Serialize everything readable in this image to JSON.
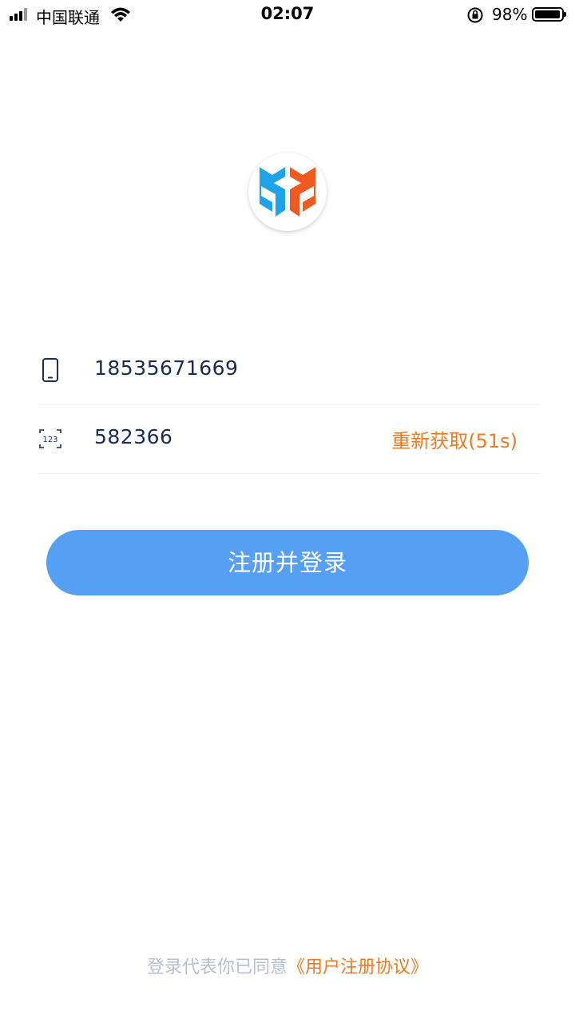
{
  "status_bar": {
    "carrier": "中国联通",
    "time": "02:07",
    "battery": "98%"
  },
  "form": {
    "phone_value": "18535671669",
    "code_value": "582366",
    "resend_label": "重新获取(51s)"
  },
  "submit_label": "注册并登录",
  "footer": {
    "agree_text": "登录代表你已同意",
    "agreement_link": "《用户注册协议》"
  },
  "colors": {
    "accent_blue": "#55a0f5",
    "accent_orange": "#f07a1f"
  }
}
